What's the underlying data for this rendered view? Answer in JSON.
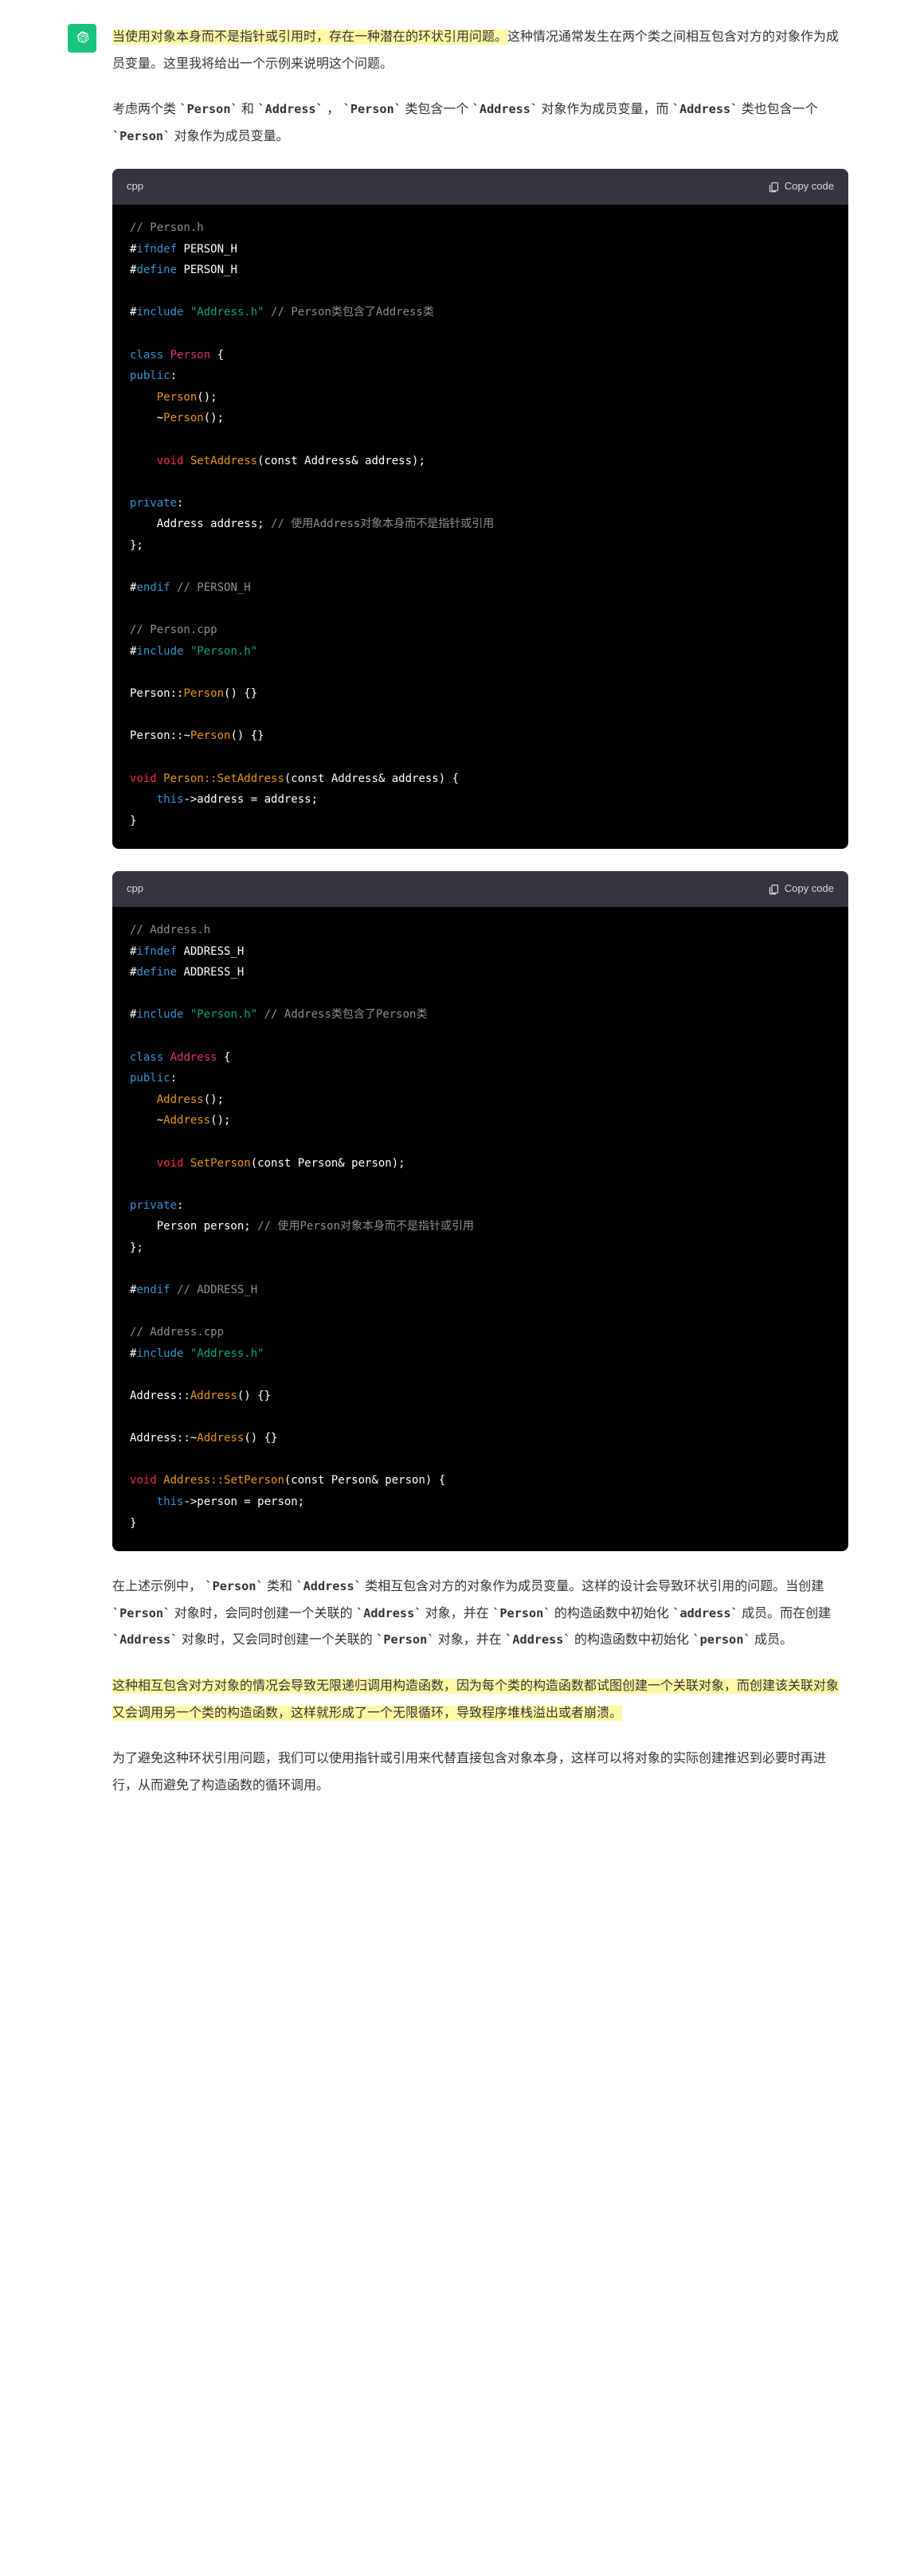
{
  "p1_highlight": "当使用对象本身而不是指针或引用时，存在一种潜在的环状引用问题。",
  "p1_rest": "这种情况通常发生在两个类之间相互包含对方的对象作为成员变量。这里我将给出一个示例来说明这个问题。",
  "p2_a": "考虑两个类 ",
  "p2_person": "`Person`",
  "p2_and": " 和 ",
  "p2_address": "`Address`",
  "p2_b": " ， ",
  "p2_person2": "`Person`",
  "p2_c": " 类包含一个 ",
  "p2_address2": "`Address`",
  "p2_d": " 对象作为成员变量，而 ",
  "p2_address3": "`Address`",
  "p2_e": " 类也包含一个 ",
  "p2_person3": "`Person`",
  "p2_f": " 对象作为成员变量。",
  "lang": "cpp",
  "copy_label": "Copy code",
  "code1": {
    "c1": "// Person.h",
    "ifndef": "ifndef",
    "define": "define",
    "ph": " PERSON_H",
    "include": "include",
    "inc_addr": " \"Address.h\"",
    "cmt_addr": " // Person类包含了Address类",
    "class": "class",
    "Person": "Person",
    "ob": " {",
    "public": "public",
    "col": ":",
    "ctor": "Person",
    "dtor": "Person",
    "void": "void",
    "setaddr": "SetAddress",
    "params": "(const Address& address)",
    "semi": ";",
    "private": "private",
    "mem": "    Address address; ",
    "cmt_mem": "// 使用Address对象本身而不是指针或引用",
    "cb": "};",
    "endif": "endif",
    "cmt_endif": " // PERSON_H",
    "c2": "// Person.cpp",
    "inc_ph": " \"Person.h\"",
    "pscope": "Person::",
    "eb": "() {}",
    "setaddr_impl1": "Person::SetAddress",
    "setaddr_impl2": "(const Address& address) {",
    "this": "this",
    "assign": "->address = address;",
    "close": "}"
  },
  "code2": {
    "c1": "// Address.h",
    "ifndef": "ifndef",
    "define": "define",
    "ah": " ADDRESS_H",
    "include": "include",
    "inc_p": " \"Person.h\"",
    "cmt_p": " // Address类包含了Person类",
    "class": "class",
    "Address": "Address",
    "ob": " {",
    "public": "public",
    "col": ":",
    "ctor": "Address",
    "dtor": "Address",
    "void": "void",
    "setp": "SetPerson",
    "params": "(const Person& person)",
    "semi": ";",
    "private": "private",
    "mem": "    Person person; ",
    "cmt_mem": "// 使用Person对象本身而不是指针或引用",
    "cb": "};",
    "endif": "endif",
    "cmt_endif": " // ADDRESS_H",
    "c2": "// Address.cpp",
    "inc_ah": " \"Address.h\"",
    "ascope": "Address::",
    "eb": "() {}",
    "setp_impl1": "Address::SetPerson",
    "setp_impl2": "(const Person& person) {",
    "this": "this",
    "assign": "->person = person;",
    "close": "}"
  },
  "p3_a": "在上述示例中， ",
  "p3_person": "`Person`",
  "p3_b": " 类和 ",
  "p3_address": "`Address`",
  "p3_c": " 类相互包含对方的对象作为成员变量。这样的设计会导致环状引用的问题。当创建 ",
  "p3_person2": "`Person`",
  "p3_d": " 对象时，会同时创建一个关联的 ",
  "p3_address2": "`Address`",
  "p3_e": " 对象，并在 ",
  "p3_person3": "`Person`",
  "p3_f": " 的构造函数中初始化 ",
  "p3_addr_m": "`address`",
  "p3_g": " 成员。而在创建 ",
  "p3_address3": "`Address`",
  "p3_h": " 对象时，又会同时创建一个关联的 ",
  "p3_person4": "`Person`",
  "p3_i": " 对象，并在 ",
  "p3_address4": "`Address`",
  "p3_j": " 的构造函数中初始化 ",
  "p3_pers_m": "`person`",
  "p3_k": " 成员。",
  "p4_highlight": "这种相互包含对方对象的情况会导致无限递归调用构造函数，因为每个类的构造函数都试图创建一个关联对象，而创建该关联对象又会调用另一个类的构造函数，这样就形成了一个无限循环，导致程序堆栈溢出或者崩溃。",
  "p5": "为了避免这种环状引用问题，我们可以使用指针或引用来代替直接包含对象本身，这样可以将对象的实际创建推迟到必要时再进行，从而避免了构造函数的循环调用。"
}
